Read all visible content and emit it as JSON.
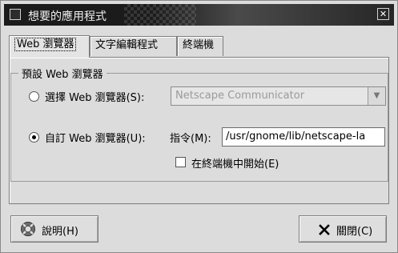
{
  "window": {
    "title": "想要的應用程式",
    "close_glyph": "✕"
  },
  "tabs": [
    {
      "label": "Web 瀏覽器",
      "active": true
    },
    {
      "label": "文字編輯程式",
      "active": false
    },
    {
      "label": "終端機",
      "active": false
    }
  ],
  "group": {
    "title": "預設 Web 瀏覽器",
    "select_option": {
      "label": "選擇 Web 瀏覽器(S):",
      "checked": false
    },
    "browser_combo": {
      "value": "Netscape Communicator",
      "enabled": false
    },
    "custom_option": {
      "label": "自訂 Web 瀏覽器(U):",
      "checked": true
    },
    "command_label": "指令(M):",
    "command_value": "/usr/gnome/lib/netscape-la",
    "terminal_check": {
      "label": "在終端機中開始(E)",
      "checked": false
    }
  },
  "buttons": {
    "help": "說明(H)",
    "close": "關閉(C)"
  },
  "icons": {
    "help": "help-lifebuoy-icon",
    "close": "close-x-icon",
    "dropdown": "chevron-down-icon",
    "window_menu": "window-menu-icon"
  }
}
